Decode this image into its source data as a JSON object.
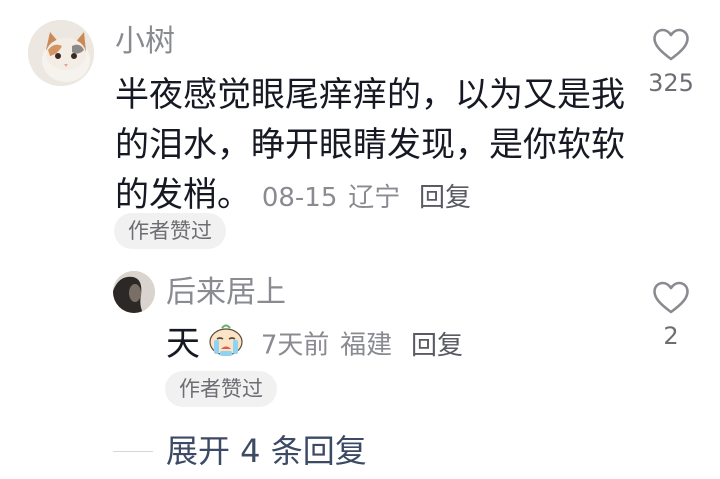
{
  "comment": {
    "username": "小树",
    "text": "半夜感觉眼尾痒痒的，以为又是我的泪水，睁开眼睛发现，是你软软的发梢。",
    "date": "08-15",
    "location": "辽宁",
    "reply_label": "回复",
    "author_liked": "作者赞过",
    "like_count": "325",
    "avatar_icon": "cat-avatar",
    "like_icon": "heart-outline-icon"
  },
  "reply": {
    "username": "后来居上",
    "text": "天",
    "emoji_icon": "crying-emoji-icon",
    "date": "7天前",
    "location": "福建",
    "reply_label": "回复",
    "author_liked": "作者赞过",
    "like_count": "2",
    "avatar_icon": "dark-portrait-avatar",
    "like_icon": "heart-outline-icon"
  },
  "expand": {
    "label": "展开 4 条回复"
  },
  "colors": {
    "text_primary": "#161823",
    "text_secondary": "#8a8b91",
    "expand_link": "#3d4a66",
    "badge_bg": "#f1f1f2"
  }
}
